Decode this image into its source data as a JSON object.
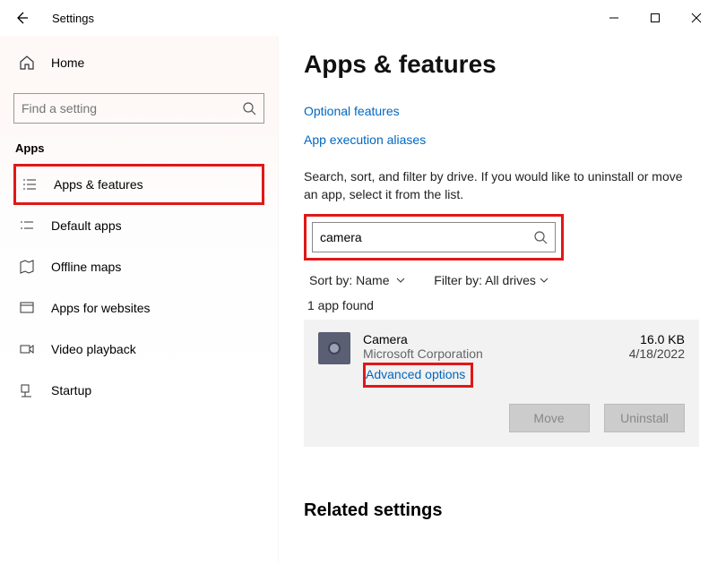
{
  "window": {
    "title": "Settings"
  },
  "sidebar": {
    "home": "Home",
    "search_placeholder": "Find a setting",
    "section": "Apps",
    "items": [
      {
        "label": "Apps & features"
      },
      {
        "label": "Default apps"
      },
      {
        "label": "Offline maps"
      },
      {
        "label": "Apps for websites"
      },
      {
        "label": "Video playback"
      },
      {
        "label": "Startup"
      }
    ]
  },
  "main": {
    "heading": "Apps & features",
    "link_optional": "Optional features",
    "link_aliases": "App execution aliases",
    "desc": "Search, sort, and filter by drive. If you would like to uninstall or move an app, select it from the list.",
    "search_value": "camera",
    "sort_label": "Sort by:",
    "sort_value": "Name",
    "filter_label": "Filter by:",
    "filter_value": "All drives",
    "found": "1 app found",
    "app": {
      "name": "Camera",
      "publisher": "Microsoft Corporation",
      "size": "16.0 KB",
      "date": "4/18/2022",
      "adv": "Advanced options"
    },
    "btn_move": "Move",
    "btn_uninstall": "Uninstall",
    "related": "Related settings"
  }
}
